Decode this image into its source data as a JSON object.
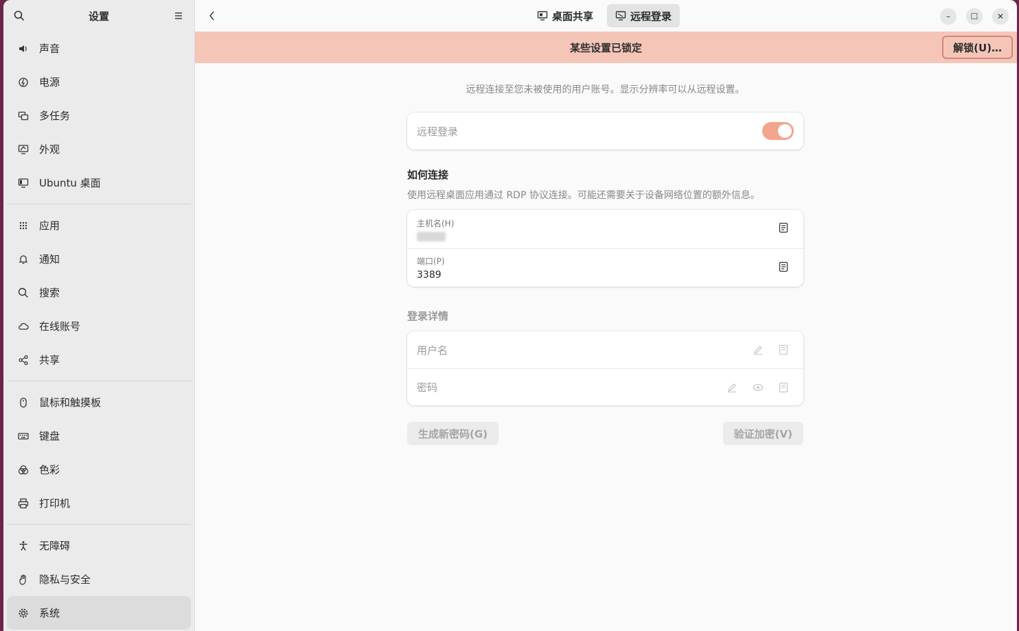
{
  "sidebar": {
    "title": "设置",
    "groups": [
      [
        {
          "label": "声音",
          "icon": "speaker-icon"
        },
        {
          "label": "电源",
          "icon": "power-icon"
        },
        {
          "label": "多任务",
          "icon": "multitasking-icon"
        },
        {
          "label": "外观",
          "icon": "appearance-icon"
        },
        {
          "label": "Ubuntu 桌面",
          "icon": "ubuntu-desktop-icon"
        }
      ],
      [
        {
          "label": "应用",
          "icon": "apps-grid-icon"
        },
        {
          "label": "通知",
          "icon": "bell-icon"
        },
        {
          "label": "搜索",
          "icon": "search-icon"
        },
        {
          "label": "在线账号",
          "icon": "cloud-icon"
        },
        {
          "label": "共享",
          "icon": "share-icon"
        }
      ],
      [
        {
          "label": "鼠标和触摸板",
          "icon": "mouse-icon"
        },
        {
          "label": "键盘",
          "icon": "keyboard-icon"
        },
        {
          "label": "色彩",
          "icon": "color-icon"
        },
        {
          "label": "打印机",
          "icon": "printer-icon"
        }
      ],
      [
        {
          "label": "无障碍",
          "icon": "accessibility-icon"
        },
        {
          "label": "隐私与安全",
          "icon": "hand-icon"
        },
        {
          "label": "系统",
          "icon": "gear-icon",
          "active": true
        }
      ]
    ]
  },
  "header": {
    "tabs": [
      {
        "label": "桌面共享",
        "icon": "desktop-sharing-icon",
        "active": false
      },
      {
        "label": "远程登录",
        "icon": "remote-login-icon",
        "active": true
      }
    ]
  },
  "banner": {
    "text": "某些设置已锁定",
    "unlock_label": "解锁(U)…"
  },
  "main": {
    "description": "远程连接至您未被使用的用户账号。显示分辨率可以从远程设置。",
    "remote_login": {
      "label": "远程登录",
      "enabled": true
    },
    "how_to_connect": {
      "title": "如何连接",
      "description": "使用远程桌面应用通过 RDP 协议连接。可能还需要关于设备网络位置的额外信息。",
      "hostname_label": "主机名(H)",
      "port_label": "端口(P)",
      "port_value": "3389"
    },
    "login_details": {
      "title": "登录详情",
      "username_label": "用户名",
      "password_label": "密码"
    },
    "buttons": {
      "generate_password": "生成新密码(G)",
      "verify_encryption": "验证加密(V)"
    }
  },
  "colors": {
    "accent": "#f2a48c",
    "banner": "#f5c6b8",
    "desktop_bg": "#6b2548"
  }
}
